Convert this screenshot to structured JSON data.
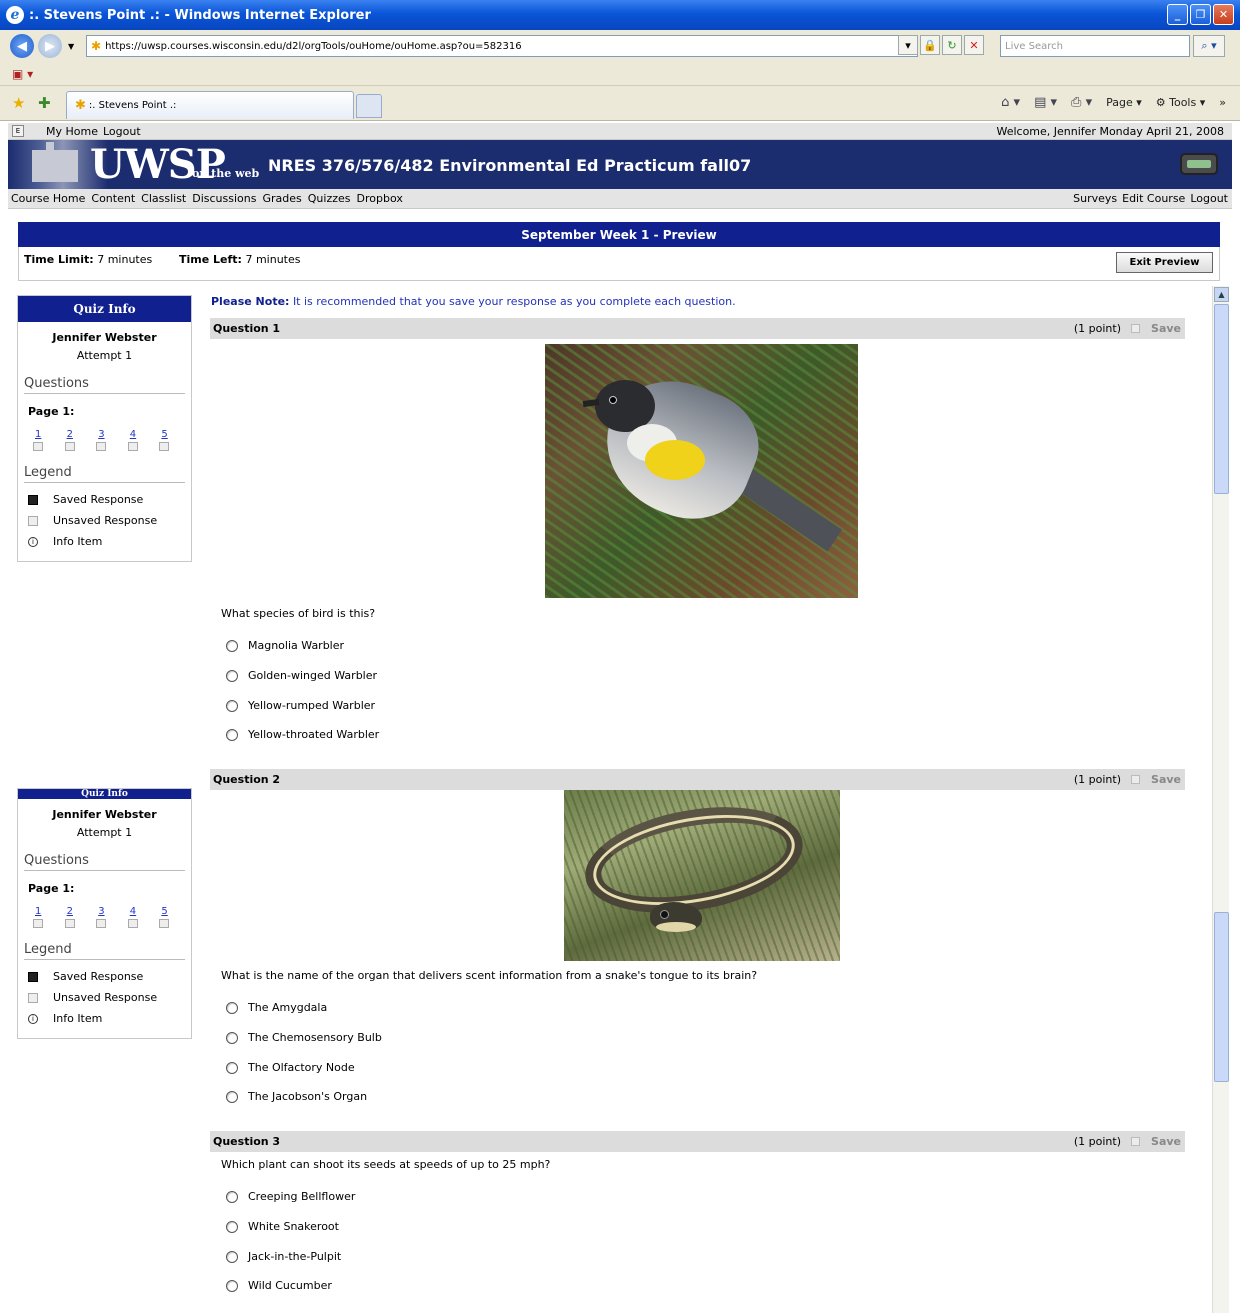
{
  "browser": {
    "window_title": ":. Stevens Point .: - Windows Internet Explorer",
    "url": "https://uwsp.courses.wisconsin.edu/d2l/orgTools/ouHome/ouHome.asp?ou=582316",
    "search_placeholder": "Live Search",
    "tab_title": ":. Stevens Point .:",
    "command_bar": {
      "page_label": "Page",
      "tools_label": "Tools"
    }
  },
  "top_nav": {
    "links": [
      "My Home",
      "Logout"
    ],
    "welcome": "Welcome, Jennifer Monday April 21, 2008"
  },
  "banner": {
    "logo": "UWSP",
    "logo_sub": "on the web",
    "course_title": "NRES 376/576/482 Environmental Ed Practicum fall07"
  },
  "course_nav": {
    "left": [
      "Course Home",
      "Content",
      "Classlist",
      "Discussions",
      "Grades",
      "Quizzes",
      "Dropbox"
    ],
    "right": [
      "Surveys",
      "Edit Course",
      "Logout"
    ]
  },
  "quiz": {
    "title": "September Week 1 - Preview",
    "time_limit_label": "Time Limit:",
    "time_limit_value": "7 minutes",
    "time_left_label": "Time Left:",
    "time_left_value": "7 minutes",
    "exit_button": "Exit Preview",
    "note_label": "Please Note:",
    "note_text": "It is recommended that you save your response as you complete each question."
  },
  "quiz_info": {
    "title": "Quiz Info",
    "name": "Jennifer Webster",
    "attempt": "Attempt 1",
    "questions_heading": "Questions",
    "page_label": "Page 1:",
    "question_numbers": [
      "1",
      "2",
      "3",
      "4",
      "5"
    ],
    "legend_heading": "Legend",
    "legend": [
      "Saved Response",
      "Unsaved Response",
      "Info Item"
    ]
  },
  "questions": [
    {
      "label": "Question 1",
      "points": "(1 point)",
      "save": "Save",
      "text": "What species of bird is this?",
      "options": [
        "Magnolia Warbler",
        "Golden-winged Warbler",
        "Yellow-rumped Warbler",
        "Yellow-throated Warbler"
      ]
    },
    {
      "label": "Question 2",
      "points": "(1 point)",
      "save": "Save",
      "text": "What is the name of the organ that delivers scent information from a snake's tongue to its brain?",
      "options": [
        "The Amygdala",
        "The Chemosensory Bulb",
        "The Olfactory Node",
        "The Jacobson's Organ"
      ]
    },
    {
      "label": "Question 3",
      "points": "(1 point)",
      "save": "Save",
      "text": "Which plant can shoot its seeds at speeds of up to 25 mph?",
      "options": [
        "Creeping Bellflower",
        "White Snakeroot",
        "Jack-in-the-Pulpit",
        "Wild Cucumber"
      ]
    }
  ]
}
